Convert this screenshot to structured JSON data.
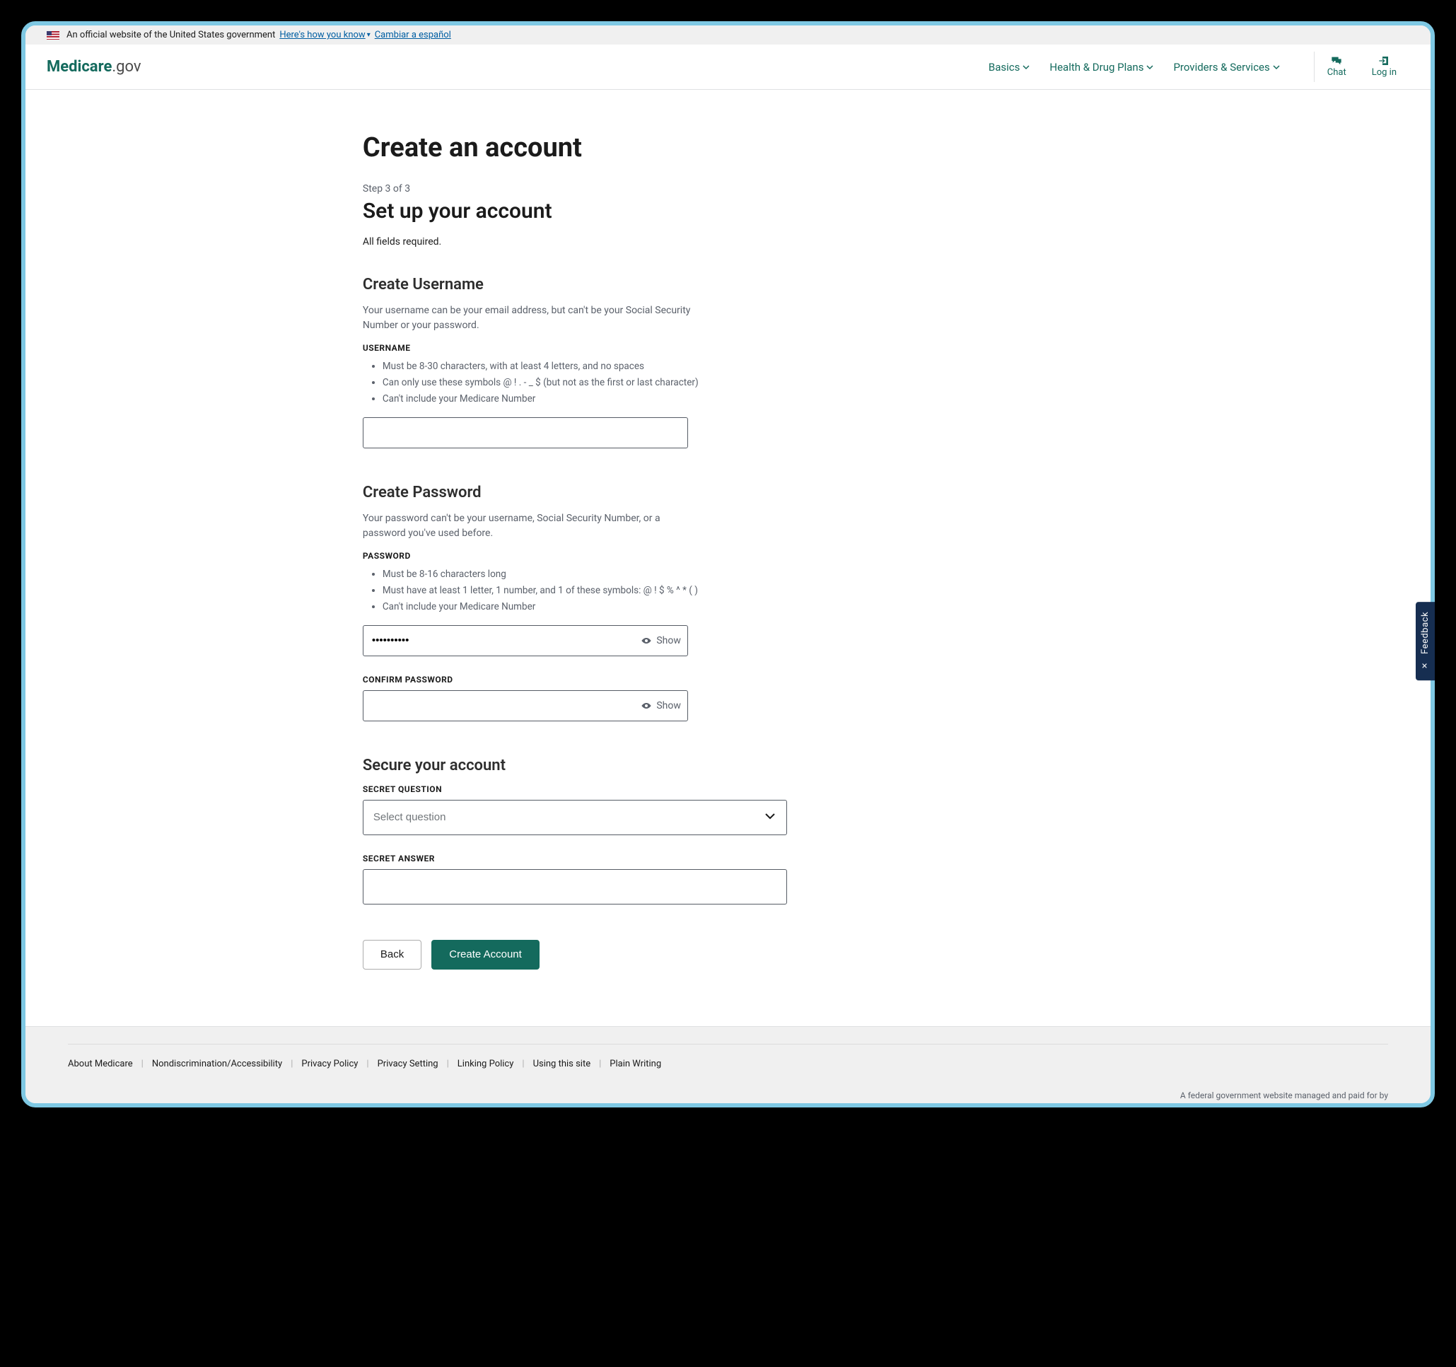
{
  "banner": {
    "text": "An official website of the United States government",
    "how_link": "Here's how you know",
    "lang_switch": "Cambiar a español"
  },
  "logo": {
    "part1": "Medicare",
    "part2": ".gov"
  },
  "nav": {
    "items": [
      "Basics",
      "Health & Drug Plans",
      "Providers & Services"
    ],
    "chat": "Chat",
    "login": "Log in"
  },
  "page": {
    "title": "Create an account",
    "step": "Step 3 of 3",
    "subtitle": "Set up your account",
    "required": "All fields required."
  },
  "username": {
    "heading": "Create Username",
    "hint": "Your username can be your email address, but can't be your Social Security Number or your password.",
    "label": "USERNAME",
    "rules": [
      "Must be 8-30 characters, with at least 4 letters, and no spaces",
      "Can only use these symbols @ ! . - _ $ (but not as the first or last character)",
      "Can't include your Medicare Number"
    ],
    "value": ""
  },
  "password": {
    "heading": "Create Password",
    "hint": "Your password can't be your username, Social Security Number, or a password you've used before.",
    "label": "PASSWORD",
    "rules": [
      "Must be 8-16 characters long",
      "Must have at least 1 letter, 1 number, and 1 of these symbols: @ ! $ % ^ * ( )",
      "Can't include your Medicare Number"
    ],
    "value": "••••••••••",
    "show": "Show",
    "confirm_label": "CONFIRM PASSWORD",
    "confirm_value": "",
    "confirm_show": "Show"
  },
  "secure": {
    "heading": "Secure your account",
    "question_label": "SECRET QUESTION",
    "question_placeholder": "Select question",
    "answer_label": "SECRET ANSWER",
    "answer_value": ""
  },
  "buttons": {
    "back": "Back",
    "create": "Create Account"
  },
  "footer": {
    "links": [
      "About Medicare",
      "Nondiscrimination/Accessibility",
      "Privacy Policy",
      "Privacy Setting",
      "Linking Policy",
      "Using this site",
      "Plain Writing"
    ],
    "note": "A federal government website managed and paid for by"
  },
  "feedback": "Feedback"
}
